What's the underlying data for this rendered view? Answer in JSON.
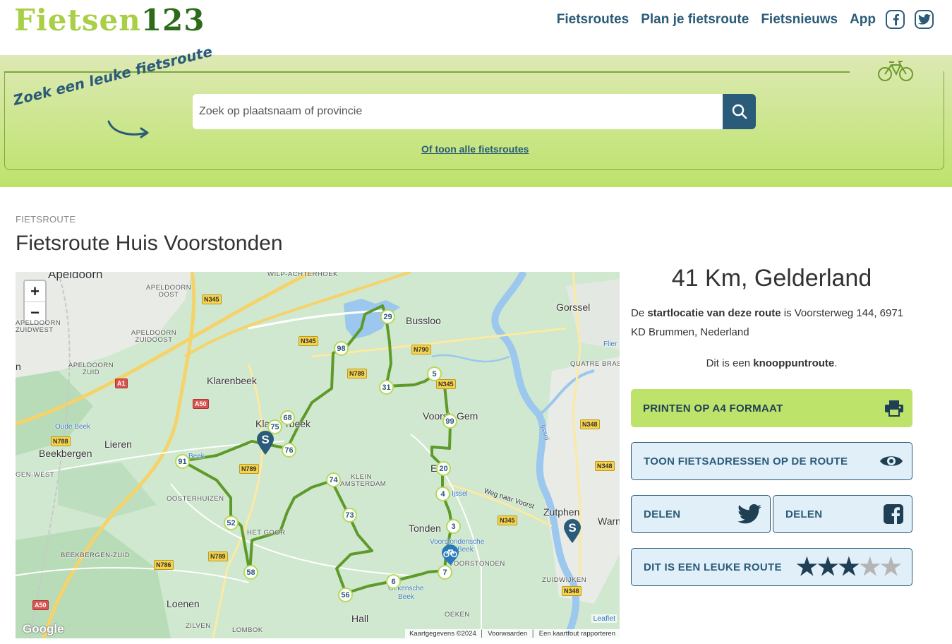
{
  "header": {
    "logo_part1": "Fietsen",
    "logo_part2": "123",
    "nav": [
      "Fietsroutes",
      "Plan je fietsroute",
      "Fietsnieuws",
      "App"
    ],
    "social_icons": [
      "facebook-icon",
      "twitter-icon"
    ]
  },
  "search": {
    "tagline": "Zoek een leuke fietsroute",
    "placeholder": "Zoek op plaatsnaam of provincie",
    "all_routes_link": "Of toon alle fietsroutes"
  },
  "route": {
    "eyebrow": "FIETSROUTE",
    "title": "Fietsroute Huis Voorstonden",
    "distance": "41 Km, Gelderland",
    "start_pre": "De ",
    "start_bold": "startlocatie van deze route",
    "start_post": " is Voorsterweg 144, 6971 KD Brummen, Nederland",
    "type_pre": "Dit is een ",
    "type_bold": "knooppuntroute",
    "type_post": "."
  },
  "buttons": {
    "print": "PRINTEN OP A4 FORMAAT",
    "show_addresses": "TOON FIETSADRESSEN OP DE ROUTE",
    "share_twitter": "DELEN",
    "share_facebook": "DELEN",
    "rate": "DIT IS EEN LEUKE ROUTE"
  },
  "rating": {
    "stars_filled": 3,
    "stars_total": 5
  },
  "map": {
    "zoom_in": "+",
    "zoom_out": "−",
    "places": [
      "Apeldoorn",
      "Bussloo",
      "Gorssel",
      "Klarenbeek",
      "Lieren",
      "Beekbergen",
      "Voorst",
      "Gem",
      "Zutphen",
      "Warn",
      "Tonden",
      "Loenen",
      "Hall",
      "Oude Beek",
      "Beek",
      "Ijssel",
      "Flier",
      "Voorstondensche",
      "Beek",
      "Weg naar Voorst",
      "Oekensche",
      "Beek",
      "Ijssel",
      "Elle",
      "Kla",
      "rbeek",
      "n"
    ],
    "small_places": [
      "WILP-ACHTERHOEK",
      "APELDOORN OOST",
      "APELDOORN ZUIDWEST",
      "APELDOORN ZUIDOOST",
      "APELDOORN ZUID",
      "GEN-WEST",
      "OOSTERHUIZEN",
      "HET GOOR",
      "BEEKBERGEN-ZUID",
      "KLEIN AMSTERDAM",
      "QUATRE BRAS",
      "VOORSTONDEN",
      "ZUIDWIJKEN",
      "OEKEN",
      "ZILVEN",
      "LOMBOK"
    ],
    "roads": [
      "N345",
      "N345",
      "N790",
      "N789",
      "N789",
      "N789",
      "A1",
      "A50",
      "N788",
      "N786",
      "A50",
      "N345",
      "N348",
      "N348",
      "N348",
      "N345"
    ],
    "nodes": [
      "29",
      "98",
      "31",
      "5",
      "99",
      "20",
      "4",
      "3",
      "7",
      "6",
      "56",
      "73",
      "74",
      "58",
      "52",
      "91",
      "76",
      "75",
      "68"
    ],
    "attribution": [
      "Kaartgegevens ©2024",
      "Voorwaarden",
      "Een kaartfout rapporteren"
    ],
    "leaflet": "Leaflet",
    "google": "Google",
    "start_marker": "S"
  },
  "colors": {
    "brand_dark": "#2a5b78",
    "logo_light": "#a9cf46",
    "logo_dark": "#2d6a1a",
    "route": "#5e9a2a",
    "button_green": "#bde36b",
    "star_filled": "#1f3f55",
    "star_empty": "#b5b5b5"
  }
}
